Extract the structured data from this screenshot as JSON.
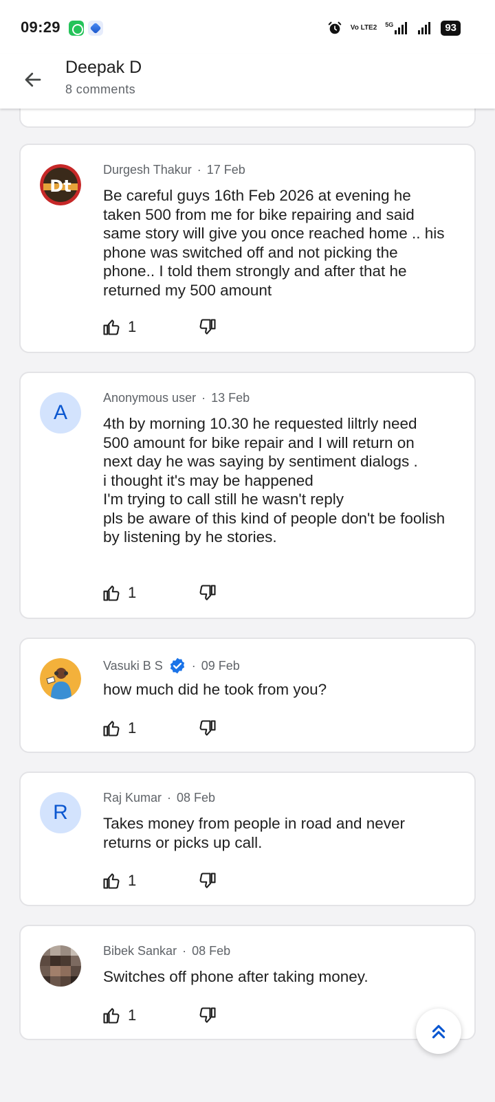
{
  "status_bar": {
    "time": "09:29",
    "battery": "93",
    "network": "5G",
    "volte": "Vo LTE2"
  },
  "header": {
    "title": "Deepak D",
    "subtitle": "8 comments"
  },
  "comments": [
    {
      "author": "Durgesh Thakur",
      "date": "17 Feb",
      "text": "Be careful guys 16th Feb 2026 at evening he taken 500 from me for bike repairing and said same story will give you once reached home .. his phone was switched off and not picking the phone.. I told them strongly and after that he returned my 500 amount",
      "likes": "1",
      "avatar_logo": "Dt"
    },
    {
      "author": "Anonymous user",
      "date": "13 Feb",
      "text": "4th by morning 10.30 he requested liltrly need 500 amount for bike repair and I will return on next day he was saying by sentiment dialogs .\ni thought it's may be happened\nI'm trying to call still he wasn't reply\npls be aware of this kind of people don't be foolish by listening by he stories.",
      "likes": "1",
      "avatar_letter": "A"
    },
    {
      "author": "Vasuki B S",
      "date": "09 Feb",
      "text": "how much did he took from you?",
      "likes": "1",
      "verified": true
    },
    {
      "author": "Raj Kumar",
      "date": "08 Feb",
      "text": "Takes money from people in road and never returns or picks up call.",
      "likes": "1",
      "avatar_letter": "R"
    },
    {
      "author": "Bibek Sankar",
      "date": "08 Feb",
      "text": "Switches off phone after taking money.",
      "likes": "1"
    }
  ],
  "meta_separator": "·",
  "colors": {
    "accent": "#0b57d0",
    "avatar_bg": "#d3e3fd",
    "verified": "#1a73e8",
    "card_border": "#e3e3e6",
    "page_bg": "#f3f3f5"
  },
  "icons": [
    "back-arrow-icon",
    "thumbs-up-icon",
    "thumbs-down-icon",
    "verified-badge-icon",
    "double-chevron-up-icon",
    "alarm-icon",
    "signal-icon"
  ]
}
